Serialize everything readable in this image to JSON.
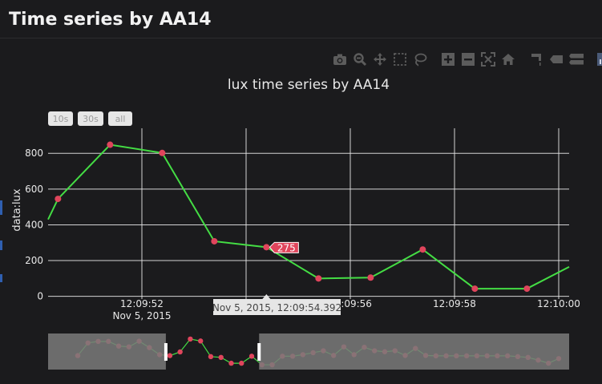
{
  "page": {
    "title": "Time series by AA14"
  },
  "modebar": {
    "buttons": [
      {
        "icon": "camera-icon",
        "label": "Download plot as png"
      },
      {
        "icon": "zoom-icon",
        "label": "Zoom"
      },
      {
        "icon": "pan-icon",
        "label": "Pan"
      },
      {
        "icon": "box-select-icon",
        "label": "Box Select"
      },
      {
        "icon": "lasso-select-icon",
        "label": "Lasso Select"
      },
      {
        "icon": "zoom-in-icon",
        "label": "Zoom in"
      },
      {
        "icon": "zoom-out-icon",
        "label": "Zoom out"
      },
      {
        "icon": "autoscale-icon",
        "label": "Autoscale"
      },
      {
        "icon": "reset-axes-icon",
        "label": "Reset axes"
      },
      {
        "icon": "spike-lines-icon",
        "label": "Toggle Spike Lines"
      },
      {
        "icon": "hover-closest-icon",
        "label": "Show closest data on hover"
      },
      {
        "icon": "hover-compare-icon",
        "label": "Compare data on hover"
      },
      {
        "icon": "plotly-logo-icon",
        "label": "Produced with Plotly"
      }
    ]
  },
  "range_selector": {
    "buttons": [
      "10s",
      "30s",
      "all"
    ]
  },
  "colors": {
    "line": "#44dd44",
    "marker": "#e0455c",
    "grid": "#e8e8e8",
    "hover_label": "#e0455c",
    "spike_label": "#e6e6e6",
    "slider_bg": "#1b1b1d",
    "slider_mask": "#7a7a7a",
    "slider_handle": "#ffffff",
    "modebar_icon": "#5c5c5c"
  },
  "chart_data": {
    "type": "line",
    "title": "lux time series by AA14",
    "ylabel": "data:lux",
    "xlabel": "",
    "x_tick_labels": [
      {
        "time": "12:09:52",
        "sub": "Nov 5, 2015",
        "t": 52
      },
      {
        "time": "12:09:54",
        "sub": "",
        "t": 54
      },
      {
        "time": "12:09:56",
        "sub": "",
        "t": 56
      },
      {
        "time": "12:09:58",
        "sub": "",
        "t": 58
      },
      {
        "time": "12:10:00",
        "sub": "",
        "t": 60
      }
    ],
    "x_range_seconds": [
      50.2,
      60.2
    ],
    "ylim": [
      -15,
      940
    ],
    "y_ticks": [
      0,
      200,
      400,
      600,
      800
    ],
    "grid": true,
    "series": [
      {
        "x": [
          "2015-11-05 12:09:50.39",
          "2015-11-05 12:09:51.39",
          "2015-11-05 12:09:52.39",
          "2015-11-05 12:09:53.39",
          "2015-11-05 12:09:54.39",
          "2015-11-05 12:09:55.39",
          "2015-11-05 12:09:56.39",
          "2015-11-05 12:09:57.39",
          "2015-11-05 12:09:58.39",
          "2015-11-05 12:09:59.39"
        ],
        "x_seconds": [
          50.39,
          51.39,
          52.39,
          53.39,
          54.39,
          55.39,
          56.39,
          57.39,
          58.39,
          59.39
        ],
        "values": [
          545,
          848,
          802,
          308,
          275,
          100,
          105,
          262,
          43,
          43
        ],
        "line_start": {
          "x_seconds": 50.2,
          "value": 430
        },
        "line_end": {
          "x_seconds": 60.2,
          "value": 165
        }
      }
    ],
    "hover": {
      "x_label": "Nov 5, 2015, 12:09:54.392",
      "x_seconds": 54.39,
      "value_label": "275",
      "value": 275
    },
    "range_slider": {
      "values": [
        275,
        600,
        640,
        640,
        520,
        500,
        645,
        480,
        300,
        275,
        370,
        700,
        650,
        250,
        230,
        80,
        80,
        260,
        40,
        40,
        260,
        260,
        300,
        350,
        400,
        280,
        500,
        300,
        490,
        400,
        375,
        400,
        280,
        460,
        280,
        270,
        270,
        270,
        270,
        270,
        270,
        270,
        270,
        250,
        230,
        160,
        80,
        200
      ],
      "window_start_fraction": 0.226,
      "window_end_fraction": 0.405
    }
  }
}
